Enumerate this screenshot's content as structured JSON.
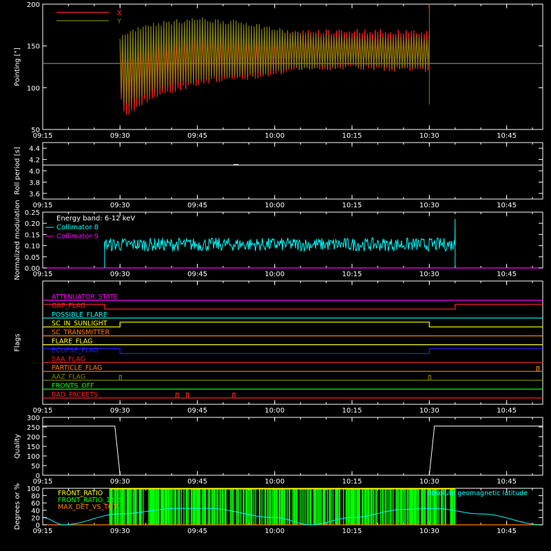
{
  "colors": {
    "background": "#000000",
    "axes": "#ffffff",
    "x": "#ff2020",
    "y": "#808000",
    "cyan": "#00ffff",
    "magenta": "#ff00ff",
    "green": "#00ff00"
  },
  "chart_data": [
    {
      "type": "line",
      "ylabel": "Pointing [\"]",
      "xlim": [
        "09:15",
        "10:52"
      ],
      "ylim": [
        50,
        200
      ],
      "y_ticks": [
        50,
        100,
        150,
        200
      ],
      "x_ticks": [
        "09:15",
        "09:30",
        "09:45",
        "10:00",
        "10:15",
        "10:30",
        "10:45"
      ],
      "legend_position": "top-left",
      "series": [
        {
          "name": "X",
          "color": "#ff2020",
          "t_start": "09:30",
          "t_end": "10:30",
          "envelope_time": [
            "09:30",
            "09:31",
            "09:35",
            "09:45",
            "09:55",
            "10:00",
            "10:05",
            "10:15",
            "10:25",
            "10:30"
          ],
          "envelope_low": [
            95,
            65,
            85,
            106,
            112,
            118,
            122,
            124,
            122,
            120
          ],
          "envelope_high": [
            148,
            152,
            158,
            170,
            164,
            162,
            167,
            168,
            167,
            166
          ]
        },
        {
          "name": "Y",
          "color": "#808000",
          "t_start": "09:30",
          "t_end": "10:30",
          "envelope_time": [
            "09:30",
            "09:31",
            "09:35",
            "09:45",
            "09:55",
            "10:00",
            "10:05",
            "10:15",
            "10:25",
            "10:30"
          ],
          "envelope_low": [
            98,
            78,
            95,
            110,
            115,
            120,
            124,
            126,
            125,
            124
          ],
          "envelope_high": [
            158,
            165,
            175,
            182,
            177,
            170,
            164,
            160,
            160,
            160
          ]
        }
      ],
      "reference_level": 129
    },
    {
      "type": "line",
      "ylabel": "Roll period [s]",
      "ylim": [
        3.5,
        4.5
      ],
      "y_ticks": [
        3.6,
        3.8,
        4.0,
        4.2,
        4.4
      ],
      "x_ticks": [
        "09:15",
        "09:30",
        "09:45",
        "10:00",
        "10:15",
        "10:30",
        "10:45"
      ],
      "series": [
        {
          "t_start": "09:15",
          "t_end": "10:52",
          "value": 4.1
        }
      ]
    },
    {
      "type": "line",
      "ylabel": "Normalized modulation",
      "ylim": [
        0,
        0.25
      ],
      "y_ticks": [
        0.0,
        0.05,
        0.1,
        0.15,
        0.2,
        0.25
      ],
      "x_ticks": [
        "09:15",
        "09:30",
        "09:45",
        "10:00",
        "10:15",
        "10:30",
        "10:45"
      ],
      "annotation": "Energy band: 6-12 keV",
      "series": [
        {
          "name": "Collimator 8",
          "color": "#00ffff",
          "t_start": "09:27",
          "t_end": "10:35",
          "mean": 0.105,
          "noise": 0.03,
          "peak_end": 0.22
        },
        {
          "name": "Collimator 9",
          "color": "#ff00ff",
          "value": 0.0
        }
      ]
    },
    {
      "type": "line",
      "ylabel": "Flags",
      "x_ticks": [
        "09:15",
        "09:30",
        "09:45",
        "10:00",
        "10:15",
        "10:30",
        "10:45"
      ],
      "flags": [
        {
          "name": "ATTENUATOR_STATE",
          "color": "#ff00ff",
          "steps": []
        },
        {
          "name": "GAP_FLAG",
          "color": "#ff2020",
          "steps": [
            [
              "09:27",
              "down"
            ],
            [
              "10:35",
              "up"
            ]
          ]
        },
        {
          "name": "POSSIBLE_FLARE",
          "color": "#00ffff",
          "steps": []
        },
        {
          "name": "SC_IN_SUNLIGHT",
          "color": "#ffff00",
          "steps": [
            [
              "09:30",
              "up"
            ],
            [
              "10:30",
              "down"
            ]
          ]
        },
        {
          "name": "SC_TRANSMITTER",
          "color": "#ff8000",
          "steps": []
        },
        {
          "name": "FLARE_FLAG",
          "color": "#ffff40",
          "steps": []
        },
        {
          "name": "ECLIPSE_FLAG",
          "color": "#2020ff",
          "steps": [
            [
              "09:30",
              "down"
            ],
            [
              "10:30",
              "up"
            ]
          ]
        },
        {
          "name": "SAA_FLAG",
          "color": "#ff2020",
          "steps": []
        },
        {
          "name": "PARTICLE_FLAG",
          "color": "#ff8000",
          "spikes": [
            "10:51"
          ]
        },
        {
          "name": "AAZ_FLAG",
          "color": "#808000",
          "spikes": [
            "09:30",
            "10:30"
          ]
        },
        {
          "name": "FRONTS_OFF",
          "color": "#00ff00",
          "steps": []
        },
        {
          "name": "BAD_PACKETS",
          "color": "#ff2020",
          "spikes": [
            "09:41",
            "09:43",
            "09:52"
          ]
        }
      ]
    },
    {
      "type": "line",
      "ylabel": "Quality",
      "ylim": [
        0,
        300
      ],
      "y_ticks": [
        0,
        50,
        100,
        150,
        200,
        250,
        300
      ],
      "x_ticks": [
        "09:15",
        "09:30",
        "09:45",
        "10:00",
        "10:15",
        "10:30",
        "10:45"
      ],
      "series": [
        {
          "time": [
            "09:15",
            "09:29",
            "09:30",
            "10:30",
            "10:31",
            "10:52"
          ],
          "values": [
            255,
            255,
            0,
            0,
            255,
            255
          ]
        }
      ]
    },
    {
      "type": "line",
      "ylabel": "Degrees or %",
      "ylim": [
        0,
        100
      ],
      "y_ticks": [
        0,
        20,
        40,
        60,
        80,
        100
      ],
      "x_ticks": [
        "09:15",
        "09:30",
        "09:45",
        "10:00",
        "10:15",
        "10:30",
        "10:45"
      ],
      "series": [
        {
          "name": "FRONT_RATIO",
          "color": "#ffff00"
        },
        {
          "name": "FRONT_RATIO_1225",
          "color": "#00ff00",
          "t_start": "09:28",
          "t_end": "10:35"
        },
        {
          "name": "MAX_DET_VS_TOT",
          "color": "#ff8000"
        },
        {
          "name": "absolute geomagnetic latitude",
          "color": "#00ffff",
          "time": [
            "09:15",
            "09:19",
            "09:30",
            "09:41",
            "09:47",
            "10:00",
            "10:07",
            "10:15",
            "10:25",
            "10:31",
            "10:40",
            "10:52"
          ],
          "values": [
            20,
            0,
            30,
            45,
            45,
            20,
            0,
            20,
            42,
            45,
            30,
            0
          ]
        }
      ]
    }
  ]
}
